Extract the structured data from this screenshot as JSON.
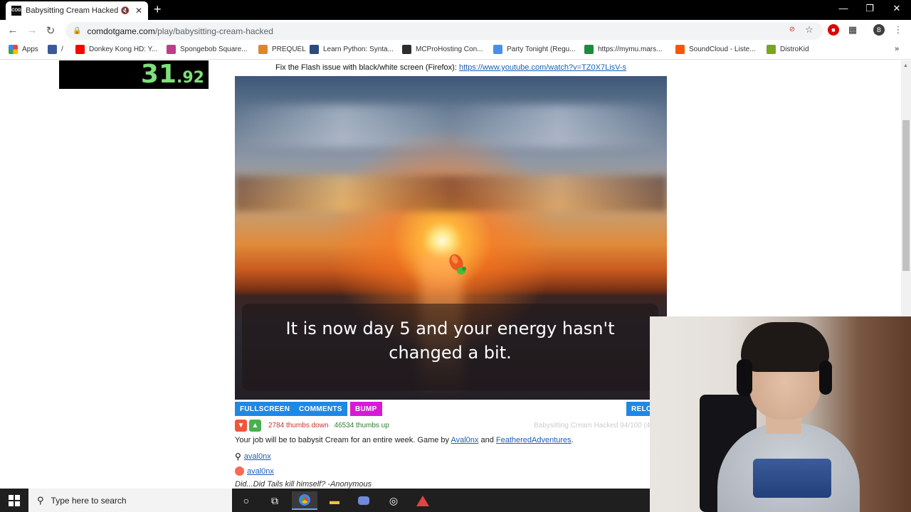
{
  "tab": {
    "title": "Babysitting Cream Hacked",
    "favicon_text": "COG"
  },
  "address": {
    "host": "comdotgame.com",
    "path": "/play/babysitting-cream-hacked"
  },
  "bookmarks": [
    {
      "label": "Apps",
      "color": "#4285f4"
    },
    {
      "label": "/",
      "color": "#3b5998"
    },
    {
      "label": "Donkey Kong HD: Y...",
      "color": "#ff0000"
    },
    {
      "label": "Spongebob Square...",
      "color": "#c23b8a"
    },
    {
      "label": "PREQUEL",
      "color": "#d88a2a"
    },
    {
      "label": "Learn Python: Synta...",
      "color": "#2b4b7a"
    },
    {
      "label": "MCProHosting Con...",
      "color": "#2d2d2d"
    },
    {
      "label": "Party Tonight (Regu...",
      "color": "#4a90e2"
    },
    {
      "label": "https://mymu.mars...",
      "color": "#1e8a3c"
    },
    {
      "label": "SoundCloud - Liste...",
      "color": "#ff5500"
    },
    {
      "label": "DistroKid",
      "color": "#7aa51e"
    }
  ],
  "timer": {
    "main": "31",
    "fraction": ".92"
  },
  "fix_note": {
    "text": "Fix the Flash issue with black/white screen (Firefox): ",
    "link": "https://www.youtube.com/watch?v=TZ0X7LisV-s"
  },
  "game": {
    "dialog": "It is now day 5 and your energy hasn't changed a bit."
  },
  "buttons": {
    "fullscreen": "FULLSCREEN",
    "comments": "COMMENTS",
    "bump": "BUMP",
    "reload": "RELO"
  },
  "stats": {
    "down": "2784 thumbs down",
    "up": "46534 thumbs up",
    "rating": "Babysitting Cream Hacked 94/100 (4"
  },
  "description": {
    "prefix": "Your job will be to babysit Cream for an entire week. Game by ",
    "author1": "Aval0nx",
    "mid": " and ",
    "author2": "FeatheredAdventures",
    "suffix": "."
  },
  "links": {
    "search_author": "aval0nx",
    "patreon_author": "aval0nx"
  },
  "quote": "Did...Did Tails kill himself? -Anonymous",
  "taskbar": {
    "search_placeholder": "Type here to search"
  },
  "colors": {
    "fullscreen": "#1e88e5",
    "comments": "#1e88e5",
    "bump": "#d61ad8",
    "reload": "#1e88e5",
    "thumbs_down": "#f0553a",
    "thumbs_up": "#4caf50",
    "down_text": "#d32f2f",
    "up_text": "#2e7d32"
  }
}
